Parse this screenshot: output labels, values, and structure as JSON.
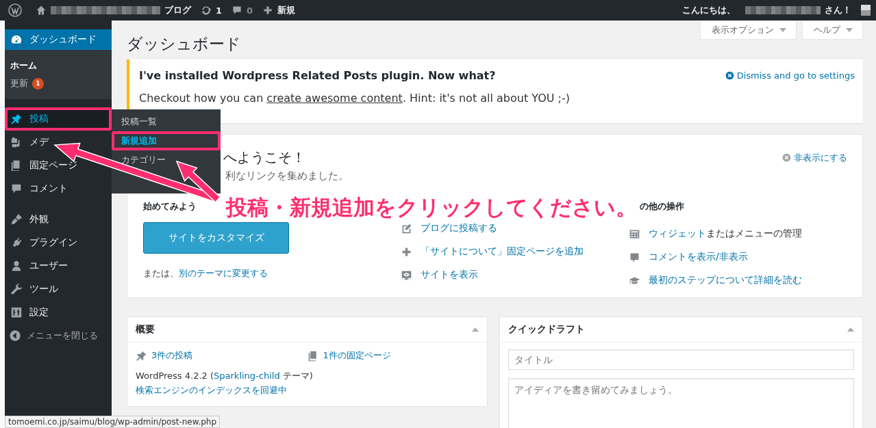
{
  "topbar": {
    "site_suffix": "ブログ",
    "updates_count": "1",
    "comments_count": "0",
    "new_label": "新規",
    "greeting": "こんにちは、",
    "greeting_suffix": "さん！"
  },
  "sidebar": {
    "items": [
      {
        "label": "ダッシュボード",
        "selected": true,
        "highlighted": false,
        "framed": false,
        "children": [
          {
            "label": "ホーム",
            "selected": true
          },
          {
            "label": "更新",
            "selected": false,
            "badge": "1"
          }
        ]
      },
      {
        "label": "投稿",
        "selected": false,
        "highlighted": true,
        "framed": true
      },
      {
        "label": "メデ",
        "selected": false,
        "highlighted": false,
        "framed": false
      },
      {
        "label": "固定ページ",
        "selected": false,
        "highlighted": false,
        "framed": false
      },
      {
        "label": "コメント",
        "selected": false,
        "highlighted": false,
        "framed": false
      },
      {
        "label": "外観",
        "selected": false,
        "highlighted": false,
        "framed": false
      },
      {
        "label": "プラグイン",
        "selected": false,
        "highlighted": false,
        "framed": false
      },
      {
        "label": "ユーザー",
        "selected": false,
        "highlighted": false,
        "framed": false
      },
      {
        "label": "ツール",
        "selected": false,
        "highlighted": false,
        "framed": false
      },
      {
        "label": "設定",
        "selected": false,
        "highlighted": false,
        "framed": false
      }
    ],
    "collapse": "メニューを閉じる"
  },
  "flyout": {
    "items": [
      {
        "label": "投稿一覧",
        "selected": false,
        "framed": false
      },
      {
        "label": "新規追加",
        "selected": true,
        "framed": true
      },
      {
        "label": "カテゴリー",
        "selected": false,
        "framed": false
      }
    ]
  },
  "screen_tabs": [
    "表示オプション",
    "ヘルプ"
  ],
  "page_title": "ダッシュボード",
  "notice": {
    "title": "I've installed Wordpress Related Posts plugin. Now what?",
    "dismiss": "Dismiss and go to settings",
    "text_before": "Checkout how you can ",
    "link": "create awesome content",
    "text_after": ". Hint: it's not all about YOU ;-)"
  },
  "welcome": {
    "title": "へようこそ！",
    "subtitle": "利なリンクを集めました。",
    "dismiss": "非表示にする",
    "start": {
      "heading": "始めてみよう",
      "button": "サイトをカスタマイズ",
      "alt_text": "または、",
      "alt_link": "別のテーマに変更する"
    },
    "next_links": [
      "ブログに投稿する",
      "「サイトについて」固定ページを追加",
      "サイトを表示"
    ],
    "more": {
      "heading": "の他の操作",
      "links": [
        {
          "link": "ウィジェット",
          "text": "またはメニューの管理"
        },
        {
          "link": "コメントを表示/非表示"
        },
        {
          "link": "最初のステップについて詳細を読む"
        }
      ]
    }
  },
  "glance": {
    "title": "概要",
    "posts": "3件の投稿",
    "pages": "1件の固定ページ",
    "version_prefix": "WordPress 4.2.2 (",
    "theme": "Sparkling-child",
    "version_suffix": " テーマ)",
    "search_notice": "検索エンジンのインデックスを回避中"
  },
  "quick_draft": {
    "title": "クイックドラフト",
    "title_placeholder": "タイトル",
    "content_placeholder": "アイディアを書き留めてみましょう。"
  },
  "status_url": "tomoemi.co.jp/saimu/blog/wp-admin/post-new.php",
  "annotation": "投稿・新規追加をクリックしてください。"
}
